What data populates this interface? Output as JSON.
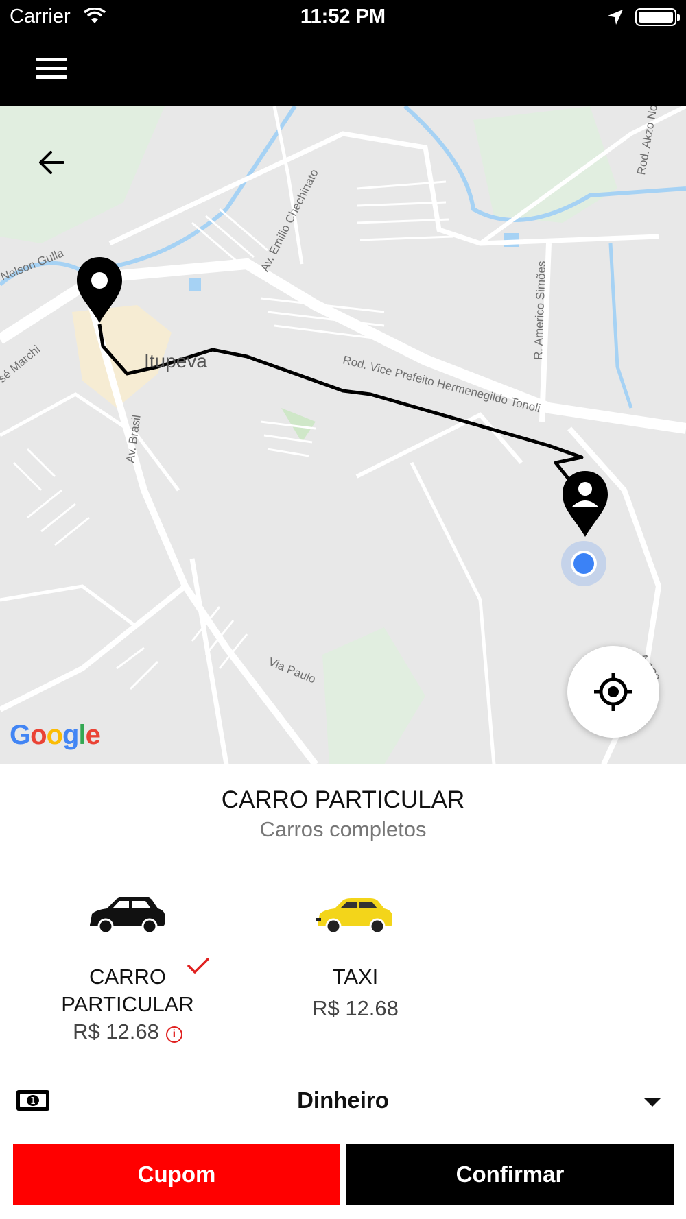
{
  "status_bar": {
    "carrier": "Carrier",
    "time": "11:52 PM"
  },
  "map": {
    "town": "Itupeva",
    "streets": {
      "nelson_gulla": "Nelson Gulla",
      "jose_marchi": "sé Marchi",
      "emilio": "Av. Emilio Chechinato",
      "americo": "R. Americo Simões",
      "akzo": "Rod. Akzo Nobe",
      "hermenegildo": "Rod. Vice Prefeito Hermenegildo Tonoli",
      "brasil": "Av. Brasil",
      "via_paulo": "Via Paulo",
      "sp120": "A 120"
    },
    "attribution": {
      "letters": [
        "G",
        "o",
        "o",
        "g",
        "l",
        "e"
      ],
      "colors": [
        "#4285F4",
        "#EA4335",
        "#FBBC05",
        "#4285F4",
        "#34A853",
        "#EA4335"
      ]
    }
  },
  "service": {
    "title": "CARRO PARTICULAR",
    "subtitle": "Carros completos"
  },
  "options": [
    {
      "name_line1": "CARRO",
      "name_line2": "PARTICULAR",
      "price": "R$ 12.68",
      "selected": true,
      "color": "#111111"
    },
    {
      "name_line1": "TAXI",
      "price": "R$ 12.68",
      "selected": false,
      "color": "#f3d51a"
    }
  ],
  "payment": {
    "method": "Dinheiro"
  },
  "buttons": {
    "coupon": "Cupom",
    "confirm": "Confirmar"
  },
  "colors": {
    "accent_red": "#ff0000",
    "dark": "#000000",
    "location_blue": "#3b82f6"
  }
}
